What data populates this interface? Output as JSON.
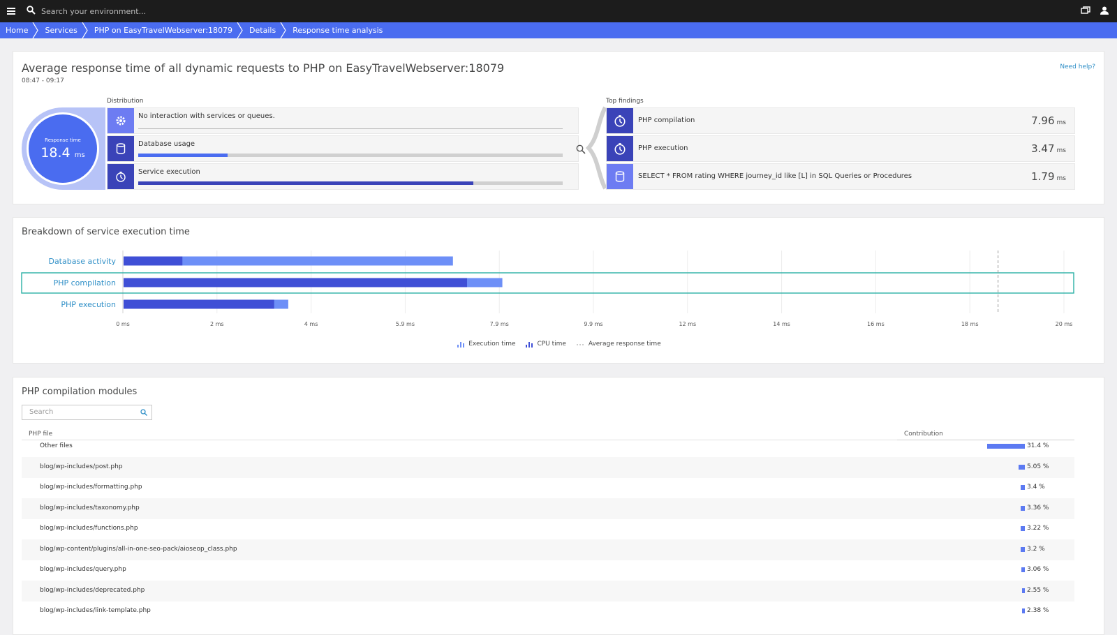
{
  "topbar": {
    "search_placeholder": "Search your environment..."
  },
  "breadcrumb": [
    "Home",
    "Services",
    "PHP on EasyTravelWebserver:18079",
    "Details",
    "Response time analysis"
  ],
  "summary": {
    "title": "Average response time of all dynamic requests to PHP on EasyTravelWebserver:18079",
    "timeframe": "08:47 - 09:17",
    "help_link": "Need help?",
    "response_time_label": "Response time",
    "response_time_value": "18.4",
    "response_time_unit": "ms",
    "distribution_label": "Distribution",
    "distribution": [
      {
        "label": "No interaction with services or queues.",
        "icon": "gear-icon",
        "fill": 0
      },
      {
        "label": "Database usage",
        "icon": "database-icon",
        "fill": 0.21
      },
      {
        "label": "Service execution",
        "icon": "stopwatch-icon",
        "fill": 0.79
      }
    ],
    "top_findings_label": "Top findings",
    "top_findings": [
      {
        "label": "PHP compilation",
        "value": "7.96",
        "unit": "ms",
        "icon": "stopwatch-icon"
      },
      {
        "label": "PHP execution",
        "value": "3.47",
        "unit": "ms",
        "icon": "stopwatch-icon"
      },
      {
        "label": "SELECT * FROM rating WHERE journey_id like [L] in SQL Queries or Procedures",
        "value": "1.79",
        "unit": "ms",
        "icon": "database-icon"
      }
    ]
  },
  "breakdown": {
    "title": "Breakdown of service execution time",
    "legend": [
      "Execution time",
      "CPU time",
      "Average response time"
    ],
    "colors": {
      "execution": "#6d8ff7",
      "cpu": "#3f4fd6",
      "average_line": "#9a9a9a",
      "highlight": "#2ab0a6",
      "label": "#2f8fc7"
    }
  },
  "chart_data": {
    "type": "bar",
    "orientation": "horizontal",
    "categories": [
      "Database activity",
      "PHP compilation",
      "PHP execution"
    ],
    "series": [
      {
        "name": "CPU time",
        "values": [
          1.25,
          7.3,
          3.2
        ]
      },
      {
        "name": "Execution time",
        "values": [
          7.0,
          8.05,
          3.5
        ]
      }
    ],
    "x_ticks": [
      "0 ms",
      "2 ms",
      "4 ms",
      "5.9 ms",
      "7.9 ms",
      "9.9 ms",
      "12 ms",
      "14 ms",
      "16 ms",
      "18 ms",
      "20 ms"
    ],
    "xlim": [
      0,
      20
    ],
    "average_response_time": 18.6,
    "highlighted": "PHP compilation"
  },
  "modules": {
    "title": "PHP compilation modules",
    "search_placeholder": "Search",
    "columns": [
      "PHP file",
      "Contribution"
    ],
    "rows": [
      {
        "file": "Other files",
        "pct": "31.4 %",
        "share": 0.314
      },
      {
        "file": "blog/wp-includes/post.php",
        "pct": "5.05 %",
        "share": 0.0505
      },
      {
        "file": "blog/wp-includes/formatting.php",
        "pct": "3.4 %",
        "share": 0.034
      },
      {
        "file": "blog/wp-includes/taxonomy.php",
        "pct": "3.36 %",
        "share": 0.0336
      },
      {
        "file": "blog/wp-includes/functions.php",
        "pct": "3.22 %",
        "share": 0.0322
      },
      {
        "file": "blog/wp-content/plugins/all-in-one-seo-pack/aioseop_class.php",
        "pct": "3.2 %",
        "share": 0.032
      },
      {
        "file": "blog/wp-includes/query.php",
        "pct": "3.06 %",
        "share": 0.0306
      },
      {
        "file": "blog/wp-includes/deprecated.php",
        "pct": "2.55 %",
        "share": 0.0255
      },
      {
        "file": "blog/wp-includes/link-template.php",
        "pct": "2.38 %",
        "share": 0.0238
      }
    ]
  }
}
